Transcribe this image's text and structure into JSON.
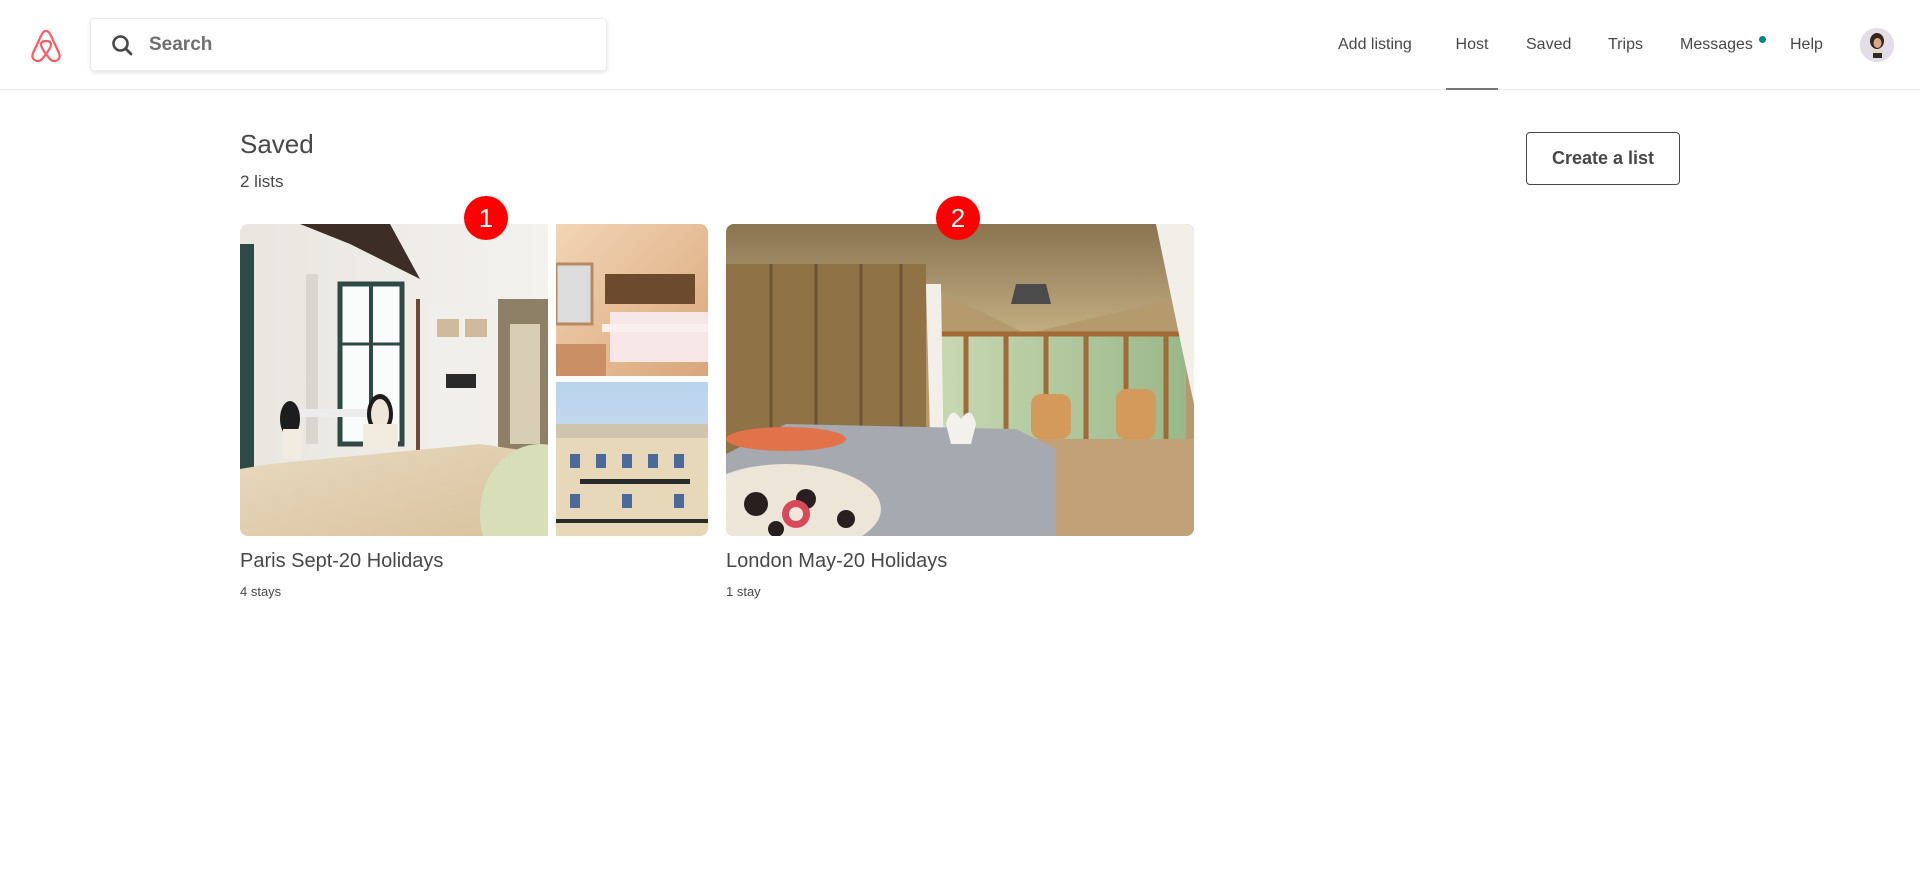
{
  "header": {
    "logo": "airbnb-logo",
    "search": {
      "placeholder": "Search",
      "value": ""
    },
    "nav": [
      {
        "label": "Add listing"
      },
      {
        "label": "Host",
        "active": true
      },
      {
        "label": "Saved"
      },
      {
        "label": "Trips"
      },
      {
        "label": "Messages",
        "notification": true
      },
      {
        "label": "Help"
      }
    ],
    "colors": {
      "brand": "#ff5a5f",
      "notification": "#008489",
      "badge": "#ff0000"
    }
  },
  "main": {
    "title": "Saved",
    "subtitle": "2 lists",
    "create_button": "Create a list",
    "lists": [
      {
        "badge": "1",
        "title": "Paris Sept-20 Holidays",
        "count": "4 stays",
        "images": [
          "bright studio bedroom with dining chairs",
          "attic bedroom",
          "Haussmann building facade"
        ]
      },
      {
        "badge": "2",
        "title": "London May-20 Holidays",
        "count": "1 stay",
        "images": [
          "thatched-roof bedroom with towel swans"
        ]
      }
    ]
  }
}
